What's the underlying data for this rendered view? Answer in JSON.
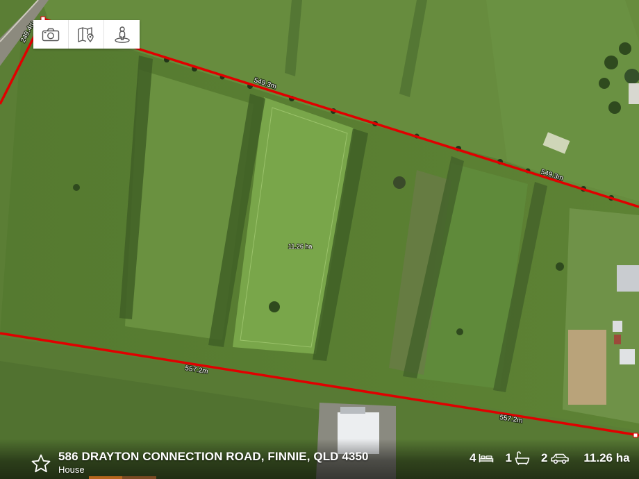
{
  "map": {
    "boundary_color": "#e00000",
    "dimensions": {
      "north_west": "549.3m",
      "north_east": "549.3m",
      "west": "249.4m",
      "south_west": "557.2m",
      "south_east": "557.2m"
    },
    "area": "11.26 ha"
  },
  "toolbar": {
    "buttons": [
      {
        "icon": "camera-icon"
      },
      {
        "icon": "map-icon"
      },
      {
        "icon": "street-view-icon"
      }
    ]
  },
  "listing": {
    "address": "586 DRAYTON CONNECTION ROAD, FINNIE, QLD 4350",
    "type": "House",
    "bedrooms": "4",
    "bathrooms": "1",
    "car_spaces": "2",
    "land_size": "11.26 ha"
  }
}
